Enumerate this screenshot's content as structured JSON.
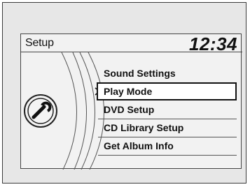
{
  "header": {
    "title": "Setup",
    "clock": "12:34"
  },
  "menu": {
    "items": [
      {
        "label": "Sound Settings",
        "selected": false
      },
      {
        "label": "Play Mode",
        "selected": true
      },
      {
        "label": "DVD Setup",
        "selected": false
      },
      {
        "label": "CD Library Setup",
        "selected": false
      },
      {
        "label": "Get Album Info",
        "selected": false
      }
    ]
  },
  "icons": {
    "category_icon": "wrench-icon",
    "selection_marker": "chevron-right-icon"
  },
  "colors": {
    "screen_bg": "#f2f2f2",
    "frame_bg": "#e7e7e7",
    "text": "#111111",
    "selected_bg": "#ffffff"
  }
}
